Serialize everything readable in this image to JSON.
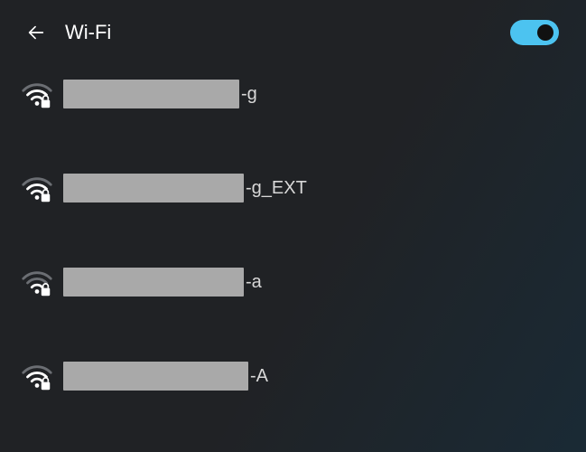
{
  "header": {
    "title": "Wi-Fi",
    "toggle_on": true
  },
  "networks": [
    {
      "signal": 3,
      "secured": true,
      "ssid_redacted": true,
      "suffix": "-g"
    },
    {
      "signal": 3,
      "secured": true,
      "ssid_redacted": true,
      "suffix": "-g_EXT"
    },
    {
      "signal": 2,
      "secured": true,
      "ssid_redacted": true,
      "suffix": "-a"
    },
    {
      "signal": 3,
      "secured": true,
      "ssid_redacted": true,
      "suffix": "-A"
    }
  ]
}
